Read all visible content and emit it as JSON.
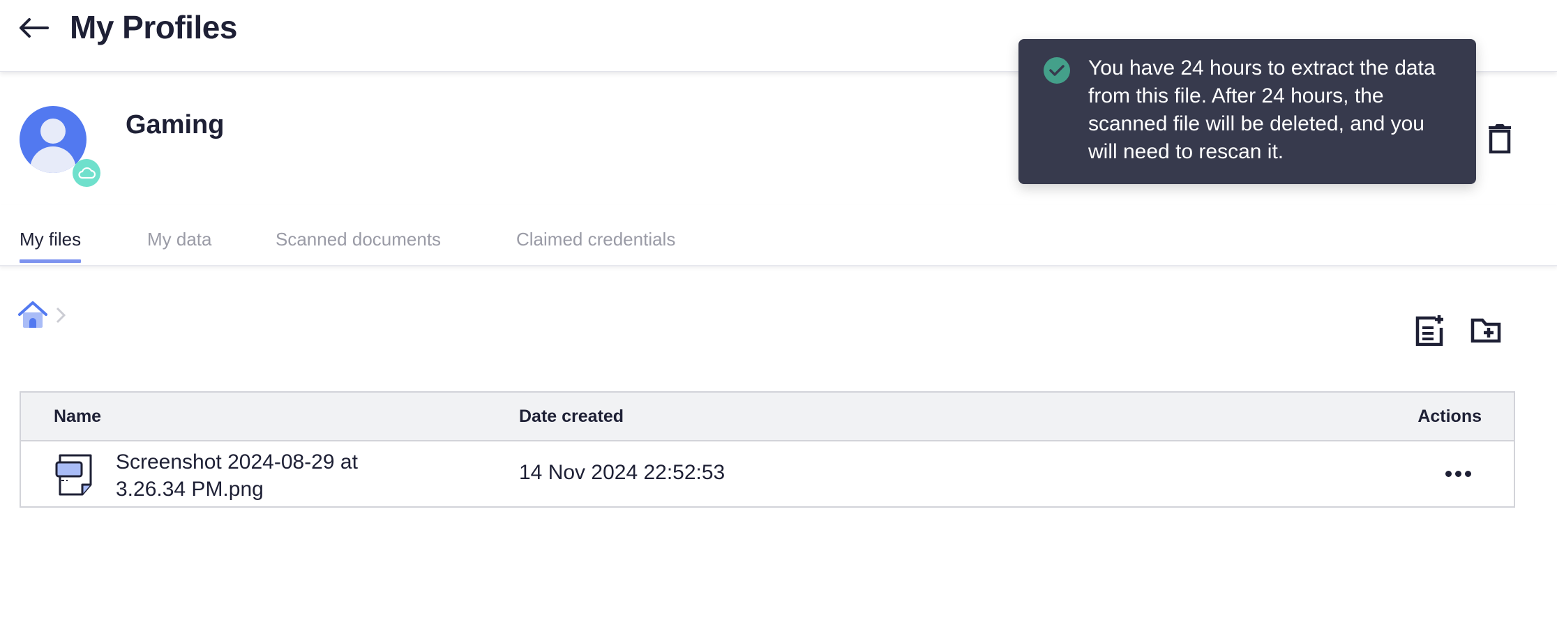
{
  "header": {
    "title": "My Profiles",
    "back_icon": "arrow-left-icon"
  },
  "profile": {
    "name": "Gaming",
    "avatar_icon": "user-avatar-icon",
    "badge_icon": "cloud-icon",
    "delete_icon": "trash-icon"
  },
  "tabs": [
    {
      "label": "My files",
      "active": true
    },
    {
      "label": "My data",
      "active": false
    },
    {
      "label": "Scanned documents",
      "active": false
    },
    {
      "label": "Claimed credentials",
      "active": false
    }
  ],
  "breadcrumb": {
    "home_icon": "home-icon",
    "separator_icon": "chevron-right-icon"
  },
  "toolbar": {
    "new_file_icon": "add-document-icon",
    "new_folder_icon": "add-folder-icon"
  },
  "table": {
    "columns": [
      "Name",
      "Date created",
      "Actions"
    ],
    "rows": [
      {
        "name_line1": "Screenshot 2024-08-29 at",
        "name_line2": "3.26.34 PM.png",
        "date_created": "14 Nov 2024 22:52:53",
        "file_icon": "image-file-icon",
        "actions_icon": "more-horizontal-icon"
      }
    ]
  },
  "toast": {
    "icon": "check-circle-icon",
    "message": "You have 24 hours to extract the data from this file. After 24 hours, the scanned file will be deleted, and you will need to rescan it."
  },
  "colors": {
    "text_primary": "#1e2035",
    "text_muted": "#9a9ba6",
    "accent": "#5279f0",
    "tab_indicator": "#7d93ef",
    "toast_bg": "#373a4d",
    "success": "#44a08a",
    "badge": "#6fe0cc"
  }
}
